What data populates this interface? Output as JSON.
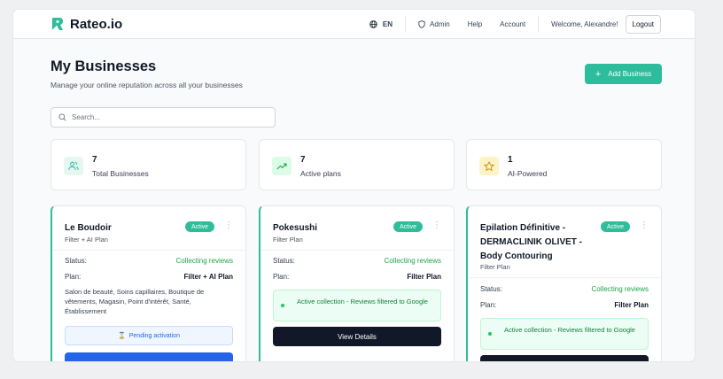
{
  "header": {
    "brand": "Rateo.io",
    "language": "EN",
    "nav": [
      "Admin",
      "Help",
      "Account"
    ],
    "welcome": "Welcome, Alexandre!",
    "logout": "Logout"
  },
  "page": {
    "title": "My Businesses",
    "subtitle": "Manage your online reputation across all your businesses",
    "add_button": "Add Business",
    "search_placeholder": "Search..."
  },
  "stats": [
    {
      "value": "7",
      "label": "Total Businesses",
      "icon": "users-icon",
      "color": "#2ebd9c"
    },
    {
      "value": "7",
      "label": "Active plans",
      "icon": "trending-up-icon",
      "color": "#22c55e"
    },
    {
      "value": "1",
      "label": "AI-Powered",
      "icon": "star-icon",
      "color": "#eab308"
    }
  ],
  "labels": {
    "status": "Status:",
    "plan": "Plan:"
  },
  "cards": [
    {
      "name": "Le Boudoir",
      "plan_label": "Filter + AI Plan",
      "badge": "Active",
      "status": "Collecting reviews",
      "plan": "Filter + AI Plan",
      "categories": "Salon de beauté, Soins capillaires, Boutique de vêtements, Magasin, Point d'intérêt, Santé, Établissement",
      "pending": "Pending activation"
    },
    {
      "name": "Pokesushi",
      "plan_label": "Filter Plan",
      "badge": "Active",
      "status": "Collecting reviews",
      "plan": "Filter Plan",
      "collection": "Active collection - Reviews filtered to Google",
      "button": "View Details"
    },
    {
      "name": "Epilation Définitive - DERMACLINIK OLIVET - Body Contouring",
      "plan_label": "Filter Plan",
      "badge": "Active",
      "status": "Collecting reviews",
      "plan": "Filter Plan",
      "collection": "Active collection - Reviews filtered to Google"
    }
  ],
  "colors": {
    "accent": "#2ebd9c",
    "primary_blue": "#2563eb",
    "dark": "#111827"
  }
}
